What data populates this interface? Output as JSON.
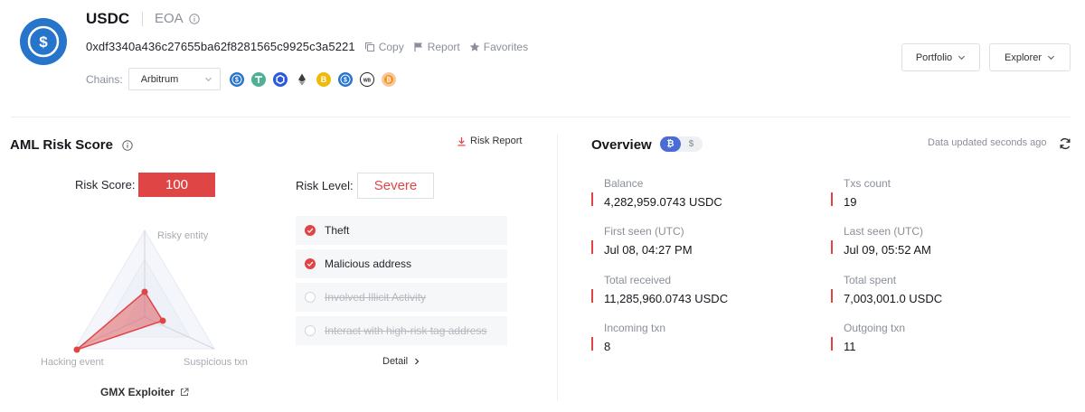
{
  "header": {
    "title": "USDC",
    "type": "EOA",
    "address": "0xdf3340a436c27655ba62f8281565c9925c3a5221",
    "copy_label": "Copy",
    "report_label": "Report",
    "favorites_label": "Favorites",
    "chains_label": "Chains:",
    "selected_chain": "Arbitrum",
    "portfolio_label": "Portfolio",
    "explorer_label": "Explorer",
    "colors": {
      "usdc_blue": "#2775ca",
      "risk_red": "#e04545",
      "accent_blue": "#4a6cd6"
    },
    "chain_icons": [
      "usdc-icon",
      "tether-icon",
      "chainlink-icon",
      "ethereum-icon",
      "bnb-icon",
      "usdc-alt-icon",
      "wbtc-icon",
      "bitcoin-icon"
    ]
  },
  "aml": {
    "title": "AML Risk Score",
    "risk_report_label": "Risk Report",
    "score_label": "Risk Score:",
    "score": "100",
    "level_label": "Risk Level:",
    "level": "Severe",
    "radar_labels": {
      "top": "Risky entity",
      "left": "Hacking event",
      "right": "Suspicious txn"
    },
    "entity": "GMX Exploiter",
    "items": [
      {
        "label": "Theft",
        "active": true
      },
      {
        "label": "Malicious address",
        "active": true
      },
      {
        "label": "Involved Illicit Activity",
        "active": false
      },
      {
        "label": "Interact with high-risk tag address",
        "active": false
      }
    ],
    "detail_label": "Detail"
  },
  "overview": {
    "title": "Overview",
    "toggle": [
      "₿",
      "$"
    ],
    "updated": "Data updated seconds ago",
    "stats": [
      {
        "label": "Balance",
        "value": "4,282,959.0743 USDC"
      },
      {
        "label": "Txs count",
        "value": "19"
      },
      {
        "label": "First seen (UTC)",
        "value": "Jul 08, 04:27 PM"
      },
      {
        "label": "Last seen (UTC)",
        "value": "Jul 09, 05:52 AM"
      },
      {
        "label": "Total received",
        "value": "11,285,960.0743 USDC"
      },
      {
        "label": "Total spent",
        "value": "7,003,001.0 USDC"
      },
      {
        "label": "Incoming txn",
        "value": "8"
      },
      {
        "label": "Outgoing txn",
        "value": "11"
      }
    ]
  }
}
